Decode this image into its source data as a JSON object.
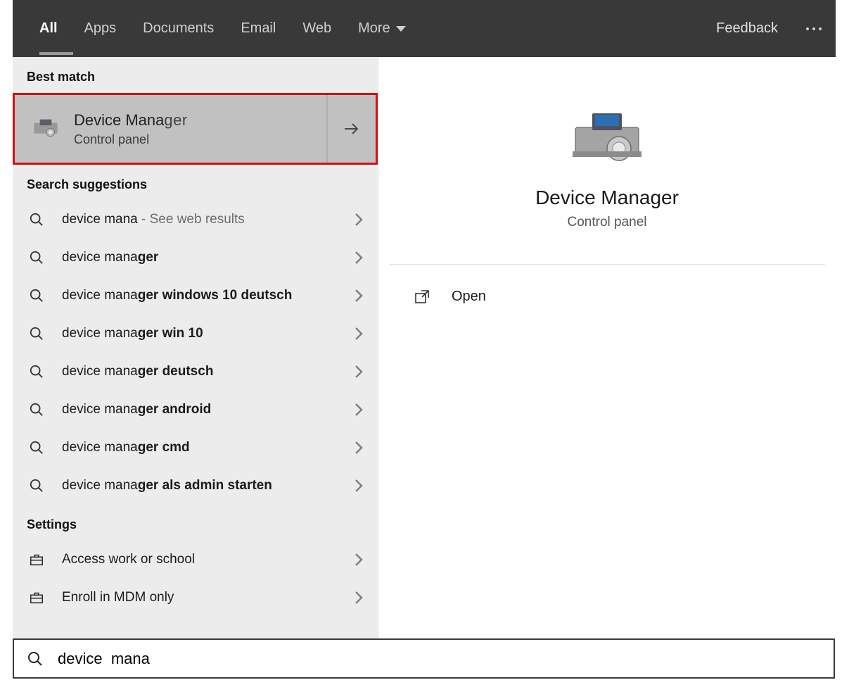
{
  "tabs": {
    "items": [
      "All",
      "Apps",
      "Documents",
      "Email",
      "Web",
      "More"
    ],
    "activeIndex": 0
  },
  "topRight": {
    "feedback": "Feedback"
  },
  "left": {
    "bestMatchLabel": "Best match",
    "bestMatch": {
      "titlePrefix": "Device Mana",
      "titleSuffix": "ger",
      "subtitle": "Control panel"
    },
    "suggestionsLabel": "Search suggestions",
    "suggestions": [
      {
        "prefix": "device mana",
        "bold": "",
        "trailGrey": " - See web results"
      },
      {
        "prefix": "device mana",
        "bold": "ger"
      },
      {
        "prefix": "device mana",
        "bold": "ger windows 10 deutsch"
      },
      {
        "prefix": "device mana",
        "bold": "ger win 10"
      },
      {
        "prefix": "device mana",
        "bold": "ger deutsch"
      },
      {
        "prefix": "device mana",
        "bold": "ger android"
      },
      {
        "prefix": "device mana",
        "bold": "ger cmd"
      },
      {
        "prefix": "device mana",
        "bold": "ger als admin starten"
      }
    ],
    "settingsLabel": "Settings",
    "settings": [
      {
        "label": "Access work or school"
      },
      {
        "label": "Enroll in MDM only"
      }
    ]
  },
  "preview": {
    "title": "Device Manager",
    "subtitle": "Control panel",
    "action": "Open"
  },
  "search": {
    "value": "device  mana"
  },
  "colors": {
    "tabsBg": "#393939",
    "leftBg": "#ececec",
    "highlightBorder": "#d70f0f",
    "highlightBg": "#c1c1c1"
  }
}
